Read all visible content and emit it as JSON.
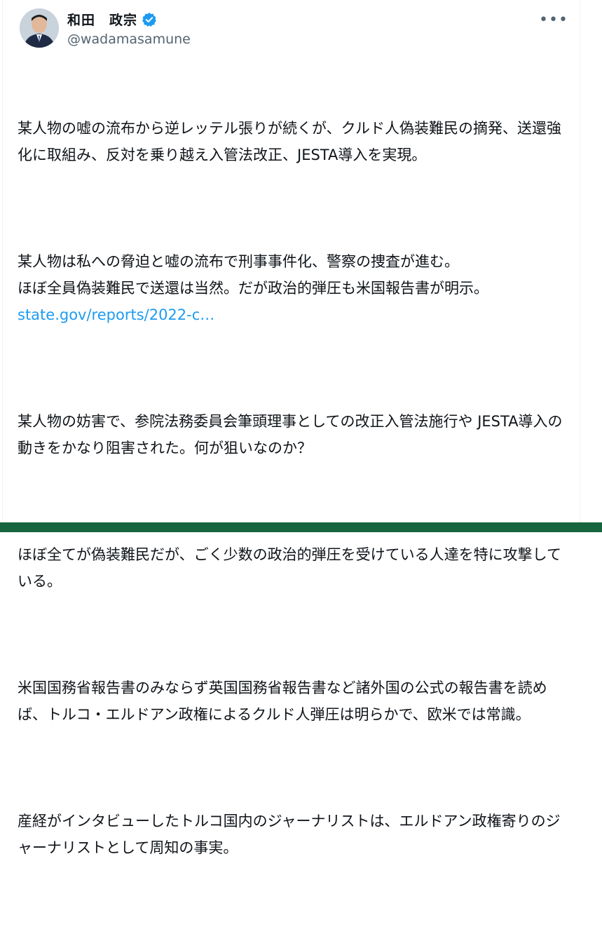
{
  "author": {
    "display_name": "和田　政宗",
    "handle": "@wadamasamune",
    "verified": true,
    "verified_color": "#1d9bf0"
  },
  "menu": {
    "more_label": "•••"
  },
  "tweet": {
    "p1": "某人物の嘘の流布から逆レッテル張りが続くが、クルド人偽装難民の摘発、送還強化に取組み、反対を乗り越え入管法改正、JESTA導入を実現。",
    "p2": "某人物は私への脅迫と嘘の流布で刑事事件化、警察の捜査が進む。\nほぼ全員偽装難民で送還は当然。だが政治的弾圧も米国報告書が明示。",
    "link": "state.gov/reports/2022-c…",
    "p3": "某人物の妨害で、参院法務委員会筆頭理事としての改正入管法施行や JESTA導入の動きをかなり阻害された。何が狙いなのか？",
    "p4": "ほぼ全てが偽装難民だが、ごく少数の政治的弾圧を受けている人達を特に攻撃している。",
    "p5": "米国国務省報告書のみならず英国国務省報告書など諸外国の公式の報告書を読めば、トルコ・エルドアン政権によるクルド人弾圧は明らかで、欧米では常識。",
    "p6": "産経がインタビューしたトルコ国内のジャーナリストは、エルドアン政権寄りのジャーナリストとして周知の事実。"
  },
  "colors": {
    "text": "#0f1419",
    "secondary": "#536471",
    "link": "#1d9bf0",
    "bottom_bar": "#17653f"
  }
}
